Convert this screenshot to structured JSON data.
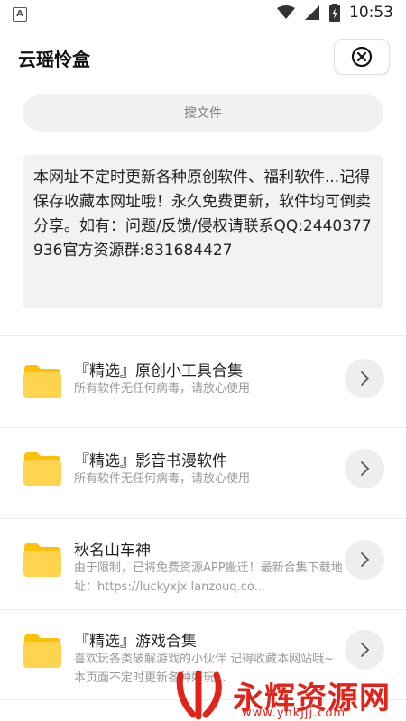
{
  "status_bar": {
    "time": "10:53",
    "app_icon_letter": "A"
  },
  "header": {
    "title": "云瑶怜盒"
  },
  "search": {
    "placeholder": "搜文件"
  },
  "notice": {
    "text": "本网址不定时更新各种原创软件、福利软件...记得保存收藏本网址哦！永久免费更新，软件均可倒卖分享。如有：问题/反馈/侵权请联系QQ:2440377936官方资源群:831684427"
  },
  "items": [
    {
      "title": "『精选』原创小工具合集",
      "subtitle": "所有软件无任何病毒，请放心使用"
    },
    {
      "title": "『精选』影音书漫软件",
      "subtitle": "所有软件无任何病毒，请放心使用"
    },
    {
      "title": "秋名山车神",
      "subtitle": "由于限制，已将免费资源APP搬迁！最新合集下载地址：https://luckyxjx.lanzouq.co..."
    },
    {
      "title": "『精选』游戏合集",
      "subtitle": "喜欢玩各类破解游戏的小伙伴 记得收藏本网站哦~本页面不定时更新各种好玩..."
    }
  ],
  "watermark": {
    "text": "永辉资源网",
    "url": "www.yhkjjj.com"
  },
  "colors": {
    "folder": "#FFD54F",
    "folder_back": "#FFC107",
    "watermark": "#E2231A"
  }
}
